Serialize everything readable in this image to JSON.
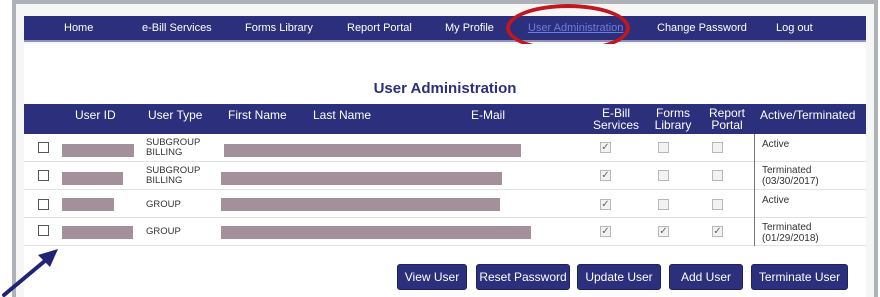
{
  "nav": {
    "items": [
      {
        "label": "Home"
      },
      {
        "label": "e-Bill Services"
      },
      {
        "label": "Forms Library"
      },
      {
        "label": "Report Portal"
      },
      {
        "label": "My Profile"
      },
      {
        "label": "User Administration"
      },
      {
        "label": "Change Password"
      },
      {
        "label": "Log out"
      }
    ],
    "active_index": 5
  },
  "page": {
    "title": "User Administration"
  },
  "table": {
    "headers": {
      "user_id": "User ID",
      "user_type": "User Type",
      "first_name": "First Name",
      "last_name": "Last Name",
      "email": "E-Mail",
      "ebill_1": "E-Bill",
      "ebill_2": "Services",
      "forms_1": "Forms",
      "forms_2": "Library",
      "report_1": "Report",
      "report_2": "Portal",
      "status": "Active/Terminated"
    },
    "rows": [
      {
        "type_1": "SUBGROUP",
        "type_2": "BILLING",
        "ebill": true,
        "forms": false,
        "report": false,
        "status_1": "Active",
        "status_2": ""
      },
      {
        "type_1": "SUBGROUP",
        "type_2": "BILLING",
        "ebill": true,
        "forms": false,
        "report": false,
        "status_1": "Terminated",
        "status_2": "(03/30/2017)"
      },
      {
        "type_1": "GROUP",
        "type_2": "",
        "ebill": true,
        "forms": false,
        "report": false,
        "status_1": "Active",
        "status_2": ""
      },
      {
        "type_1": "GROUP",
        "type_2": "",
        "ebill": true,
        "forms": true,
        "report": true,
        "status_1": "Terminated",
        "status_2": "(01/29/2018)"
      }
    ]
  },
  "buttons": {
    "view_user": "View User",
    "reset_password": "Reset Password",
    "update_user": "Update User",
    "add_user": "Add User",
    "terminate_user": "Terminate User"
  },
  "colors": {
    "primary": "#2b2f7c",
    "highlight": "#c0181e",
    "redaction": "#a4909a",
    "active_link": "#6b7fe0"
  }
}
